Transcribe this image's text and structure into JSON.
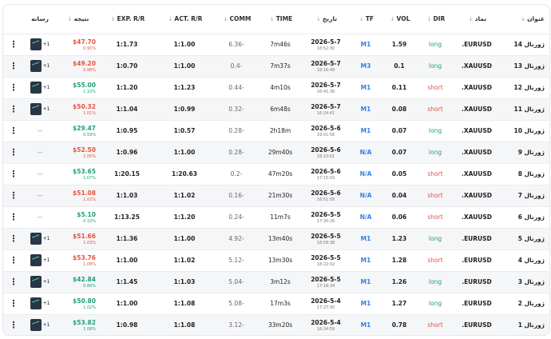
{
  "headers": {
    "title": "عنوان",
    "symbol": "نماد",
    "dir": "DIR",
    "vol": "VOL",
    "tf": "TF",
    "date": "تاریخ",
    "time": "TIME",
    "comm": "COMM",
    "act_rr": "ACT. R/R",
    "exp_rr": "EXP. R/R",
    "result": "نتیجه",
    "media": "رسانه"
  },
  "rows": [
    {
      "title": "ژورنال 14",
      "symbol": "EURUSD.",
      "dir": "long",
      "vol": "1.59",
      "tf": "M1",
      "date": "2026-5-7",
      "clock": "18:52:30",
      "time": "7m46s",
      "comm": "-6.36",
      "act_rr": "1:1.00",
      "exp_rr": "1:1.73",
      "result": "$47.70",
      "pct": "0.95%",
      "sign": "neg",
      "media": "thumb",
      "media_count": "1+"
    },
    {
      "title": "ژورنال 13",
      "symbol": "XAUUSD.",
      "dir": "long",
      "vol": "0.1",
      "tf": "M3",
      "date": "2026-5-7",
      "clock": "18:16:49",
      "time": "7m37s",
      "comm": "-0.4",
      "act_rr": "1:1.00",
      "exp_rr": "1:0.70",
      "result": "$49.20",
      "pct": "0.98%",
      "sign": "neg",
      "media": "thumb",
      "media_count": "1+"
    },
    {
      "title": "ژورنال 12",
      "symbol": "XAUUSD.",
      "dir": "short",
      "vol": "0.11",
      "tf": "M1",
      "date": "2026-5-7",
      "clock": "16:41:36",
      "time": "4m10s",
      "comm": "-0.44",
      "act_rr": "1:1.23",
      "exp_rr": "1:1.20",
      "result": "$55.00",
      "pct": "1.10%",
      "sign": "pos",
      "media": "thumb",
      "media_count": "1+"
    },
    {
      "title": "ژورنال 11",
      "symbol": "XAUUSD.",
      "dir": "short",
      "vol": "0.08",
      "tf": "M1",
      "date": "2026-5-7",
      "clock": "16:24:41",
      "time": "6m48s",
      "comm": "-0.32",
      "act_rr": "1:0.99",
      "exp_rr": "1:1.04",
      "result": "$50.32",
      "pct": "1.01%",
      "sign": "neg",
      "media": "thumb",
      "media_count": "1+"
    },
    {
      "title": "ژورنال 10",
      "symbol": "XAUUSD.",
      "dir": "long",
      "vol": "0.07",
      "tf": "M1",
      "date": "2026-5-6",
      "clock": "19:01:56",
      "time": "2h18m",
      "comm": "-0.28",
      "act_rr": "1:0.57",
      "exp_rr": "1:0.95",
      "result": "$29.47",
      "pct": "0.59%",
      "sign": "pos",
      "media": "dash",
      "media_count": ""
    },
    {
      "title": "ژورنال 9",
      "symbol": "XAUUSD.",
      "dir": "long",
      "vol": "0.07",
      "tf": "N/A",
      "date": "2026-5-6",
      "clock": "18:10:01",
      "time": "29m40s",
      "comm": "-0.28",
      "act_rr": "1:1.00",
      "exp_rr": "1:0.96",
      "result": "$52.50",
      "pct": "1.05%",
      "sign": "neg",
      "media": "dash",
      "media_count": ""
    },
    {
      "title": "ژورنال 8",
      "symbol": "XAUUSD.",
      "dir": "short",
      "vol": "0.05",
      "tf": "N/A",
      "date": "2026-5-6",
      "clock": "17:15:03",
      "time": "47m20s",
      "comm": "-0.2",
      "act_rr": "1:20.63",
      "exp_rr": "1:20.15",
      "result": "$53.65",
      "pct": "1.07%",
      "sign": "pos",
      "media": "dash",
      "media_count": ""
    },
    {
      "title": "ژورنال 7",
      "symbol": "XAUUSD.",
      "dir": "short",
      "vol": "0.04",
      "tf": "N/A",
      "date": "2026-5-6",
      "clock": "16:51:58",
      "time": "21m30s",
      "comm": "-0.16",
      "act_rr": "1:1.02",
      "exp_rr": "1:1.03",
      "result": "$51.08",
      "pct": "1.02%",
      "sign": "neg",
      "media": "dash",
      "media_count": ""
    },
    {
      "title": "ژورنال 6",
      "symbol": "XAUUSD.",
      "dir": "short",
      "vol": "0.06",
      "tf": "N/A",
      "date": "2026-5-5",
      "clock": "17:30:26",
      "time": "11m7s",
      "comm": "-0.24",
      "act_rr": "1:1.20",
      "exp_rr": "1:13.25",
      "result": "$5.10",
      "pct": "0.10%",
      "sign": "pos",
      "media": "dash",
      "media_count": ""
    },
    {
      "title": "ژورنال 5",
      "symbol": "EURUSD.",
      "dir": "long",
      "vol": "1.23",
      "tf": "M1",
      "date": "2026-5-5",
      "clock": "18:58:38",
      "time": "13m40s",
      "comm": "-4.92",
      "act_rr": "1:1.00",
      "exp_rr": "1:1.36",
      "result": "$51.66",
      "pct": "1.03%",
      "sign": "neg",
      "media": "thumb",
      "media_count": "1+"
    },
    {
      "title": "ژورنال 4",
      "symbol": "EURUSD.",
      "dir": "short",
      "vol": "1.28",
      "tf": "M1",
      "date": "2026-5-5",
      "clock": "18:22:02",
      "time": "13m30s",
      "comm": "-5.12",
      "act_rr": "1:1.02",
      "exp_rr": "1:1.00",
      "result": "$53.76",
      "pct": "1.08%",
      "sign": "neg",
      "media": "thumb",
      "media_count": "1+"
    },
    {
      "title": "ژورنال 3",
      "symbol": "EURUSD.",
      "dir": "long",
      "vol": "1.26",
      "tf": "M1",
      "date": "2026-5-5",
      "clock": "17:18:34",
      "time": "3m12s",
      "comm": "-5.04",
      "act_rr": "1:1.03",
      "exp_rr": "1:1.45",
      "result": "$42.84",
      "pct": "0.86%",
      "sign": "pos",
      "media": "thumb",
      "media_count": "1+"
    },
    {
      "title": "ژورنال 2",
      "symbol": "EURUSD.",
      "dir": "long",
      "vol": "1.27",
      "tf": "M1",
      "date": "2026-5-4",
      "clock": "17:27:30",
      "time": "17m3s",
      "comm": "-5.08",
      "act_rr": "1:1.08",
      "exp_rr": "1:1.00",
      "result": "$50.80",
      "pct": "1.02%",
      "sign": "pos",
      "media": "thumb",
      "media_count": "1+"
    },
    {
      "title": "ژورنال 1",
      "symbol": "EURUSD.",
      "dir": "short",
      "vol": "0.78",
      "tf": "M1",
      "date": "2026-5-4",
      "clock": "16:34:59",
      "time": "33m20s",
      "comm": "-3.12",
      "act_rr": "1:1.08",
      "exp_rr": "1:0.98",
      "result": "$53.82",
      "pct": "1.08%",
      "sign": "pos",
      "media": "thumb",
      "media_count": "1+"
    }
  ]
}
